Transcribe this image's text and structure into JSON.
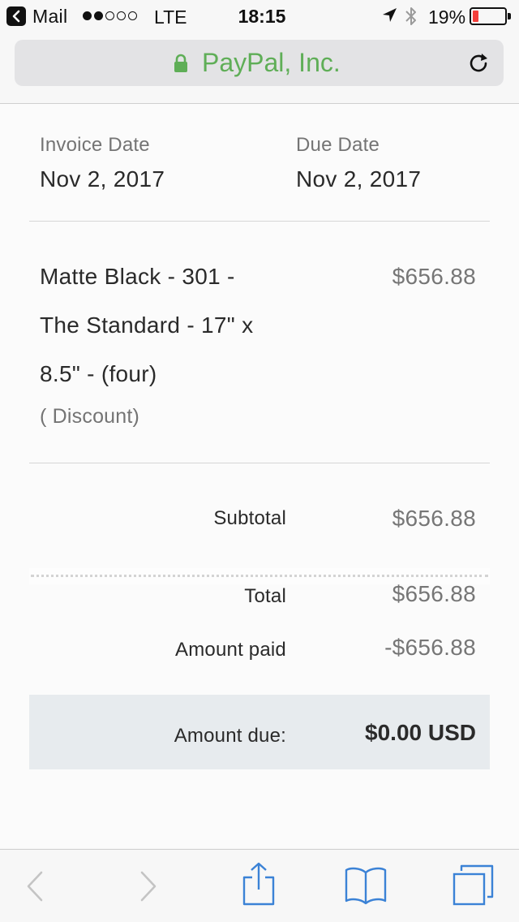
{
  "status_bar": {
    "back_app": "Mail",
    "carrier": "LTE",
    "time": "18:15",
    "battery_percent": "19%",
    "battery_level": 0.19,
    "signal_bars_filled": 2,
    "signal_bars_total": 5
  },
  "address_bar": {
    "site_name": "PayPal, Inc.",
    "site_color": "#5fae57"
  },
  "invoice": {
    "invoice_date_label": "Invoice Date",
    "invoice_date": "Nov 2, 2017",
    "due_date_label": "Due Date",
    "due_date": "Nov 2, 2017",
    "item": {
      "lines": [
        "Matte Black - 301 -",
        "The Standard - 17\" x",
        "8.5\" - (four)"
      ],
      "note": "( Discount)",
      "price": "$656.88"
    },
    "subtotal_label": "Subtotal",
    "subtotal": "$656.88",
    "total_label": "Total",
    "total": "$656.88",
    "amount_paid_label": "Amount paid",
    "amount_paid": "-$656.88",
    "amount_due_label": "Amount due:",
    "amount_due": "$0.00 USD"
  },
  "colors": {
    "accent_green": "#5fae57",
    "toolbar_blue": "#3b82d6",
    "toolbar_disabled": "#c4c4c4",
    "battery_low": "#f33e3a"
  },
  "toolbar": {
    "icons": [
      "back-arrow-icon",
      "forward-arrow-icon",
      "share-icon",
      "bookmarks-icon",
      "tabs-icon"
    ]
  }
}
